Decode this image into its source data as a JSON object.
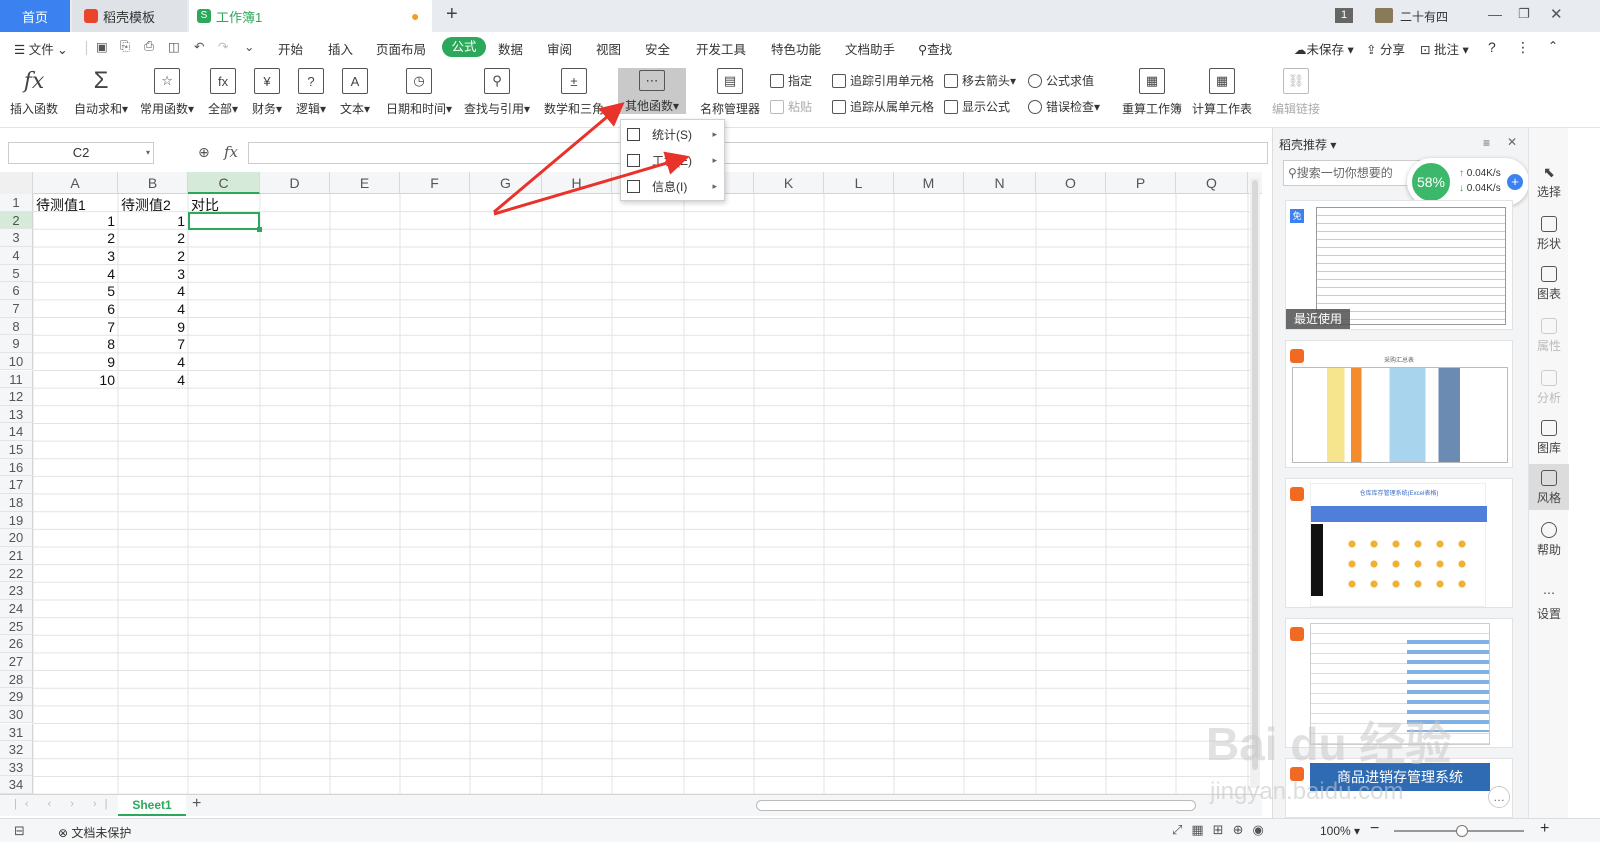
{
  "titlebar": {
    "tabs": [
      {
        "label": "首页"
      },
      {
        "label": "稻壳模板"
      },
      {
        "label": "工作簿1"
      }
    ],
    "new_tab": "+",
    "window_count": "1",
    "date": "二十有四",
    "accent": "#3b82f0",
    "wps_green": "#2ca85a"
  },
  "menu": {
    "file": "文件",
    "tabs": [
      "开始",
      "插入",
      "页面布局",
      "公式",
      "数据",
      "审阅",
      "视图",
      "安全",
      "开发工具",
      "特色功能",
      "文档助手"
    ],
    "search": "查找",
    "unsaved": "未保存",
    "share": "分享",
    "comment": "批注"
  },
  "ribbon": {
    "big": [
      {
        "label": "插入函数",
        "icon": "fx-icon"
      },
      {
        "label": "自动求和",
        "icon": "sigma-icon"
      },
      {
        "label": "常用函数",
        "icon": "common-func-icon"
      },
      {
        "label": "全部",
        "icon": "all-func-icon"
      },
      {
        "label": "财务",
        "icon": "finance-icon"
      },
      {
        "label": "逻辑",
        "icon": "logic-icon"
      },
      {
        "label": "文本",
        "icon": "text-icon"
      },
      {
        "label": "日期和时间",
        "icon": "clock-icon"
      },
      {
        "label": "查找与引用",
        "icon": "lookup-icon"
      },
      {
        "label": "数学和三角",
        "icon": "math-icon"
      },
      {
        "label": "其他函数",
        "icon": "more-func-icon"
      },
      {
        "label": "名称管理器",
        "icon": "name-manager-icon"
      },
      {
        "label": "重算工作簿",
        "icon": "recalc-book-icon"
      },
      {
        "label": "计算工作表",
        "icon": "calc-sheet-icon"
      },
      {
        "label": "编辑链接",
        "icon": "edit-link-icon"
      }
    ],
    "small": {
      "assign": "指定",
      "paste": "粘贴",
      "trace_prec": "追踪引用单元格",
      "trace_dep": "追踪从属单元格",
      "remove_arrows": "移去箭头",
      "show_formula": "显示公式",
      "eval_formula": "公式求值",
      "error_check": "错误检查"
    }
  },
  "formula_bar": {
    "name_box": "C2",
    "fx": "fx",
    "value": ""
  },
  "grid": {
    "columns": [
      "A",
      "B",
      "C",
      "D",
      "E",
      "F",
      "G",
      "H",
      "I",
      "J",
      "K",
      "L",
      "M",
      "N",
      "O",
      "P",
      "Q"
    ],
    "rows": [
      "1",
      "2",
      "3",
      "4",
      "5",
      "6",
      "7",
      "8",
      "9",
      "10",
      "11",
      "12",
      "13",
      "14",
      "15",
      "16",
      "17",
      "18",
      "19",
      "20",
      "21",
      "22",
      "23",
      "24",
      "25",
      "26",
      "27",
      "28",
      "29",
      "30",
      "31",
      "32",
      "33",
      "34"
    ],
    "headers": [
      "待测值1",
      "待测值2",
      "对比"
    ],
    "colA": [
      "1",
      "2",
      "3",
      "4",
      "5",
      "6",
      "7",
      "8",
      "9",
      "10"
    ],
    "colB": [
      "1",
      "2",
      "2",
      "3",
      "4",
      "4",
      "9",
      "7",
      "4",
      "4"
    ],
    "active_cell": "C2"
  },
  "dropdown": {
    "items": [
      {
        "label": "统计(S)"
      },
      {
        "label": "工程(E)"
      },
      {
        "label": "信息(I)"
      }
    ]
  },
  "panel": {
    "title": "稻壳推荐",
    "search_placeholder": "搜索一切你想要的",
    "net_percent": "58%",
    "up": "0.04K/s",
    "down": "0.04K/s",
    "recent_badge": "最近使用",
    "card2_title": "采购汇总表",
    "card3_title": "仓库库存管理系统(Excel表格)",
    "card5_title": "商品进销存管理系统"
  },
  "sidebar": [
    "选择",
    "形状",
    "图表",
    "属性",
    "分析",
    "图库",
    "风格",
    "帮助",
    "设置"
  ],
  "sheetbar": {
    "sheet": "Sheet1",
    "add": "+"
  },
  "status": {
    "protect": "文档未保护",
    "zoom": "100%"
  },
  "watermark": {
    "logo": "Bai du 经验",
    "url": "jingyan.baidu.com"
  }
}
